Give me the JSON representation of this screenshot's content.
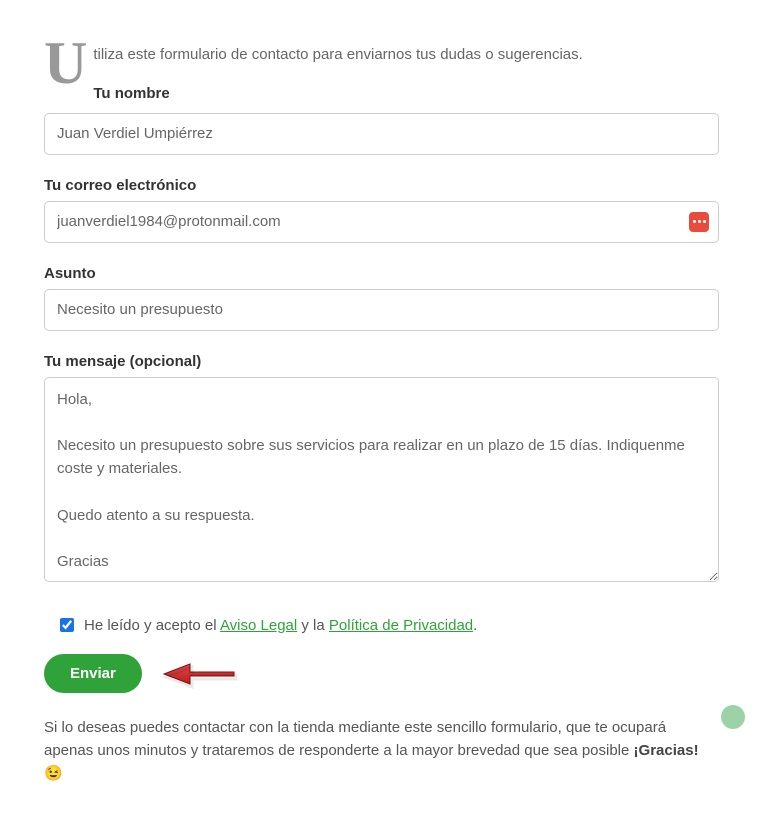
{
  "intro": "tiliza este formulario de contacto para enviarnos tus dudas o sugerencias.",
  "dropcap": "U",
  "fields": {
    "name": {
      "label": "Tu nombre",
      "value": "Juan Verdiel Umpiérrez"
    },
    "email": {
      "label": "Tu correo electrónico",
      "value": "juanverdiel1984@protonmail.com"
    },
    "subject": {
      "label": "Asunto",
      "value": "Necesito un presupuesto"
    },
    "message": {
      "label": "Tu mensaje (opcional)",
      "value": "Hola,\n\nNecesito un presupuesto sobre sus servicios para realizar en un plazo de 15 días. Indiquenme coste y materiales.\n\nQuedo atento a su respuesta.\n\nGracias"
    }
  },
  "consent": {
    "checked": true,
    "prefix": "He leído y acepto el ",
    "link1": "Aviso Legal",
    "mid": " y la ",
    "link2": "Política de Privacidad",
    "suffix": "."
  },
  "submit_label": "Enviar",
  "footer": {
    "text": "Si lo deseas puedes contactar con la tienda mediante este sencillo formulario, que te ocupará apenas unos minutos y trataremos de responderte a la mayor brevedad que sea posible ",
    "bold": "¡Gracias!",
    "emoji": " 😉"
  }
}
